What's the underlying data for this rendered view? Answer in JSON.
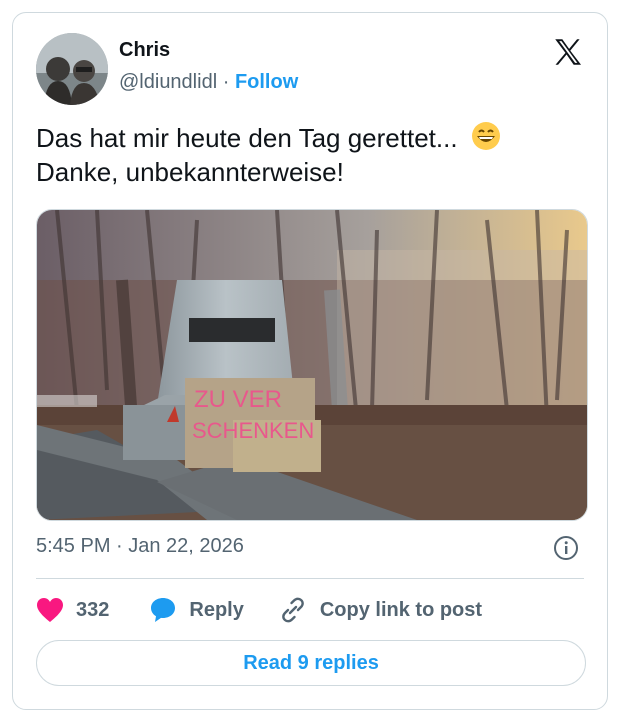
{
  "tweet": {
    "author_name": "Chris",
    "handle": "@ldiundlidl",
    "separator": "·",
    "follow_label": "Follow",
    "text_line1": "Das hat mir heute den Tag gerettet...",
    "text_line2": "Danke, unbekannterweise!",
    "emoji": "grinning-face-emoji",
    "sign_text_line1": "ZU VER",
    "sign_text_line2": "SCHENKEN",
    "timestamp": "5:45 PM · Jan 22, 2026",
    "like_count": "332",
    "reply_label": "Reply",
    "copy_link_label": "Copy link to post",
    "read_replies_label": "Read 9 replies"
  },
  "icons": {
    "platform": "x-logo-icon",
    "info": "info-icon",
    "like": "heart-icon",
    "reply": "speech-bubble-icon",
    "copy": "link-icon"
  },
  "colors": {
    "accent": "#1d9bf0",
    "like": "#f91880",
    "secondary_text": "#536471",
    "border": "#cfd9de"
  }
}
